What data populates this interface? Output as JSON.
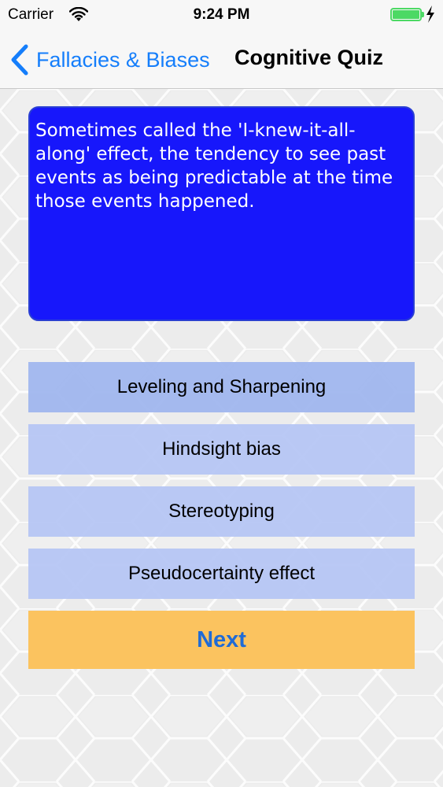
{
  "status_bar": {
    "carrier": "Carrier",
    "time": "9:24 PM",
    "battery_level": 1.0,
    "wifi_icon": "wifi-icon",
    "charging_icon": "bolt-icon"
  },
  "nav": {
    "back_label": "Fallacies & Biases",
    "title": "Cognitive Quiz",
    "back_icon": "chevron-left-icon"
  },
  "question": {
    "text": "Sometimes called the 'I-knew-it-all-along' effect, the tendency to see past events as being predictable at the time those events happened."
  },
  "answers": [
    {
      "label": "Leveling and Sharpening"
    },
    {
      "label": "Hindsight bias"
    },
    {
      "label": "Stereotyping"
    },
    {
      "label": "Pseudocertainty effect"
    }
  ],
  "next_label": "Next",
  "colors": {
    "accent": "#157efb",
    "question_bg": "#1717fb",
    "answer_bg": "#b4c4f4",
    "next_bg": "#fbc35f",
    "next_text": "#1f6bd6",
    "battery": "#4cd964"
  }
}
